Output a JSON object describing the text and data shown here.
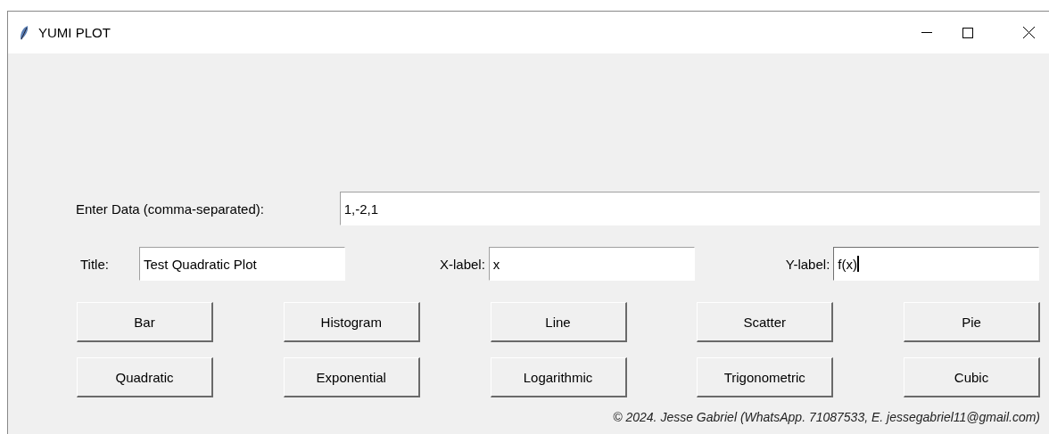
{
  "window": {
    "title": "YUMI PLOT"
  },
  "data_field": {
    "label": "Enter Data (comma-separated):",
    "value": "1,-2,1",
    "focused": false
  },
  "label_fields": [
    {
      "label": "Title:",
      "value": "Test Quadratic Plot",
      "focused": false
    },
    {
      "label": "X-label:",
      "value": "x",
      "focused": false
    },
    {
      "label": "Y-label:",
      "value": "f(x)",
      "focused": true
    }
  ],
  "button_rows": [
    [
      "Bar",
      "Histogram",
      "Line",
      "Scatter",
      "Pie"
    ],
    [
      "Quadratic",
      "Exponential",
      "Logarithmic",
      "Trigonometric",
      "Cubic"
    ]
  ],
  "footer": "© 2024. Jesse Gabriel (WhatsApp. 71087533, E. jessegabriel11@gmail.com)"
}
